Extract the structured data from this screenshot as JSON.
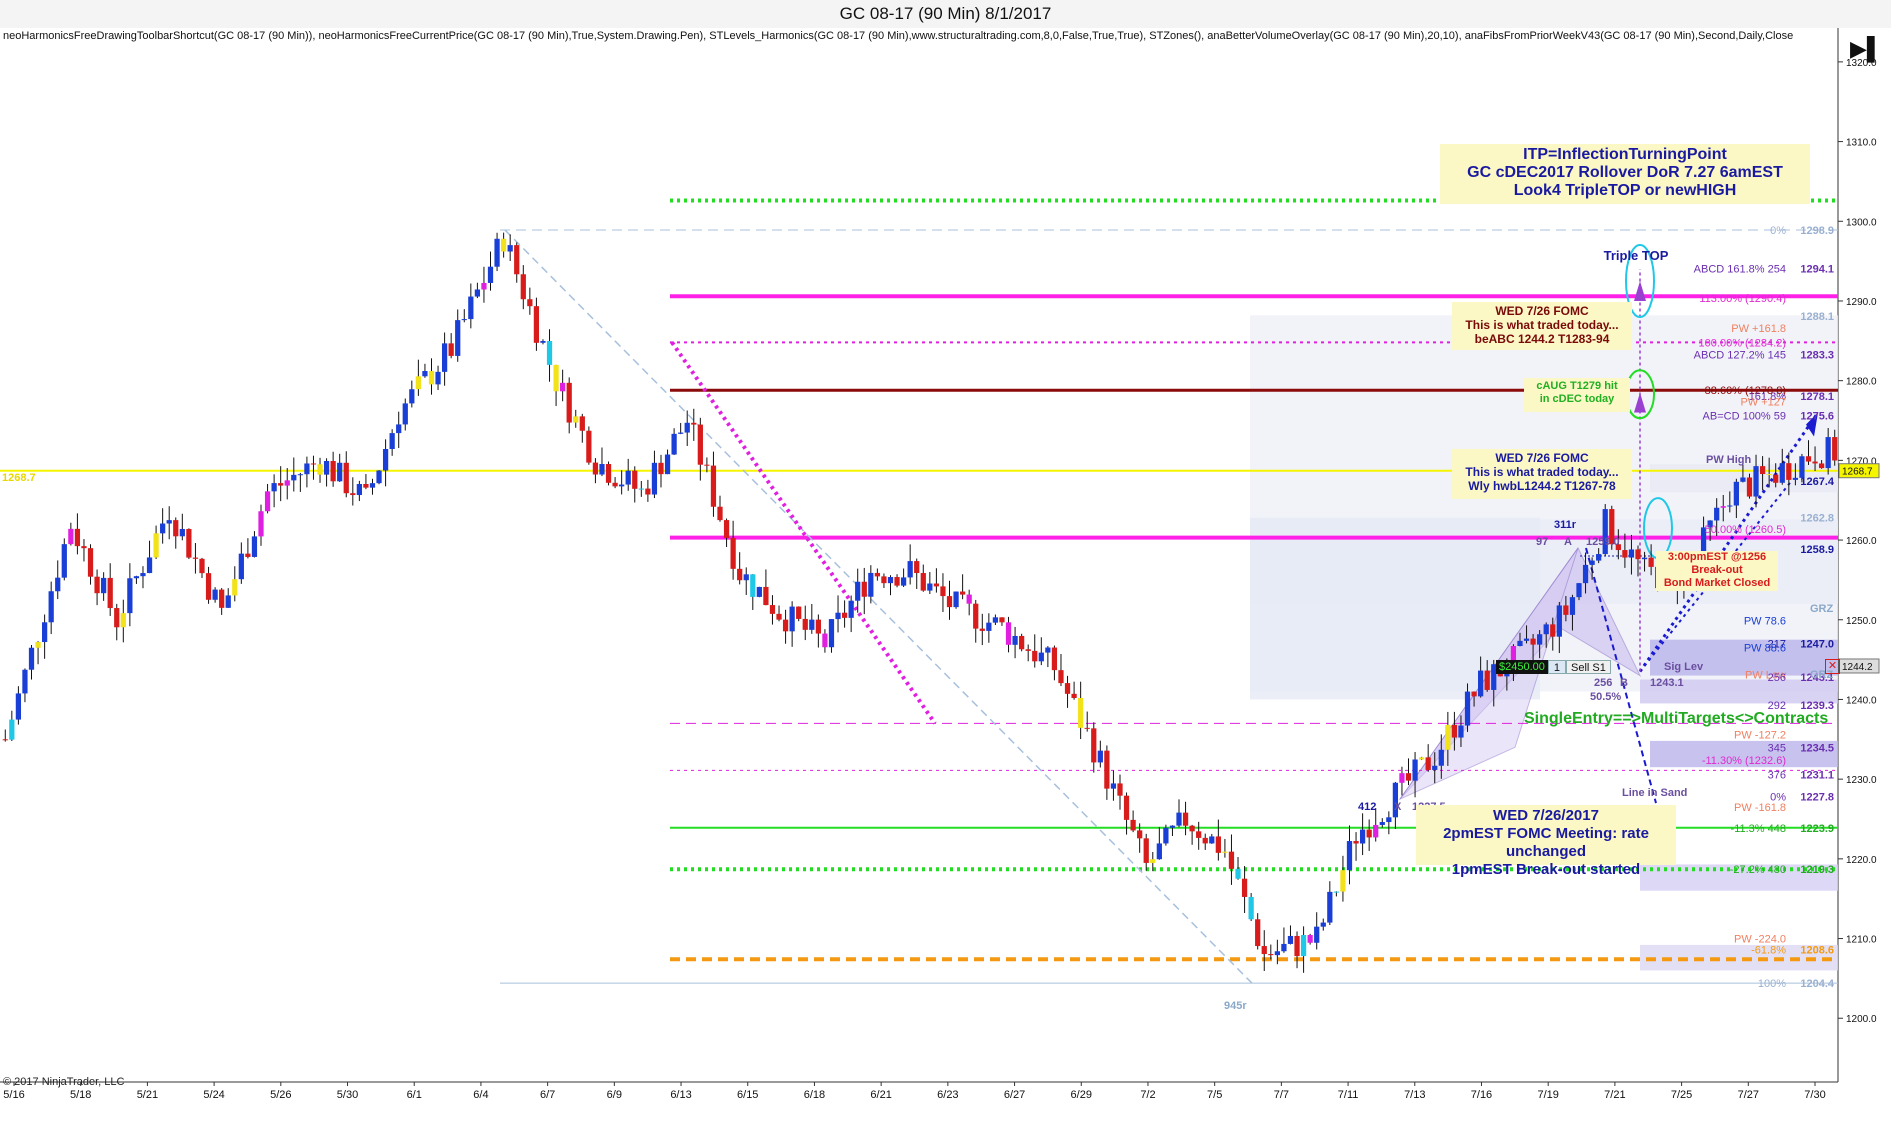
{
  "window": {
    "title": "GC 08-17 (90 Min)  8/1/2017"
  },
  "indicators_line": "neoHarmonicsFreeDrawingToolbarShortcut(GC 08-17 (90 Min)), neoHarmonicsFreeCurrentPrice(GC 08-17 (90 Min),True,System.Drawing.Pen), STLevels_Harmonics(GC 08-17 (90 Min),www.structuraltrading.com,8,0,False,True,True), STZones(), anaBetterVolumeOverlay(GC 08-17 (90 Min),20,10), anaFibsFromPriorWeekV43(GC 08-17 (90 Min),Second,Daily,Close",
  "copyright": "© 2017 NinjaTrader, LLC",
  "icons": {
    "play": "play-end-icon",
    "close_marker": "close-x-icon"
  },
  "colors": {
    "up_candle": "#1a3fd6",
    "down_candle": "#d81b1b",
    "doji_yellow": "#f2e21a",
    "doji_magenta": "#e020e0",
    "doji_cyan": "#20c8e8",
    "magenta_level": "#ff20e8",
    "darkred_level": "#8b0a0a",
    "yellow_level": "#f5f500",
    "green_level": "#22dd22",
    "orange_level": "#f39a11",
    "note_bg": "#fbf8c6"
  },
  "annotations": {
    "itp_box": [
      "ITP=InflectionTurningPoint",
      "GC cDEC2017 Rollover DoR 7.27 6amEST",
      "Look4 TripleTOP or newHIGH"
    ],
    "fomc_top": [
      "WED 7/26 FOMC",
      "This is what traded today...",
      "beABC 1244.2 T1283-94"
    ],
    "fomc_mid": [
      "WED 7/26 FOMC",
      "This is what traded today...",
      "Wly hwbL1244.2 T1267-78"
    ],
    "fomc_bottom": [
      "WED 7/26/2017",
      "2pmEST FOMC Meeting: rate unchanged",
      "1pmEST Break-out started"
    ],
    "triple_top": "Triple TOP",
    "caug": [
      "cAUG T1279 hit",
      "in cDEC today"
    ],
    "close_note": [
      "3:00pmEST @1256",
      "Break-out",
      "Bond Market Closed"
    ],
    "single_entry": "SingleEntry==>MultiTargets<>Contracts",
    "position": [
      "$2450.00",
      "1",
      "Sell S1"
    ],
    "line_in_sand": "Line in Sand",
    "left_price": "1268.7",
    "pattern_labels": [
      {
        "text": "311r",
        "color": "#1a1aa0"
      },
      {
        "text": "97",
        "color": "#6a4fa0"
      },
      {
        "text": "A",
        "color": "#6a4fa0"
      },
      {
        "text": "412",
        "color": "#1a1aa0"
      },
      {
        "text": "X",
        "color": "#6a4fa0"
      },
      {
        "text": "1227.5",
        "color": "#6a4fa0"
      },
      {
        "text": "945r",
        "color": "#8aa8c8"
      },
      {
        "text": "256",
        "color": "#6a4fa0"
      },
      {
        "text": "B",
        "color": "#6a4fa0"
      },
      {
        "text": "1243.1",
        "color": "#6a4fa0"
      },
      {
        "text": "50.5%",
        "color": "#6a4fa0"
      },
      {
        "text": "Sig Lev",
        "color": "#6a4fa0"
      },
      {
        "text": "1259.0",
        "color": "#6a4fa0"
      },
      {
        "text": "Line in Sand",
        "color": "#6a4fa0"
      },
      {
        "text": "PW High",
        "color": "#6a4fa0"
      },
      {
        "text": "GRZ",
        "color": "#8aa8c8"
      },
      {
        "text": "GRZ",
        "color": "#8aa8c8"
      }
    ]
  },
  "price_scale_tags": [
    {
      "price": 1268.7,
      "label": "1268.7",
      "bg": "#f5f500"
    },
    {
      "price": 1244.2,
      "label": "1244.2",
      "bg": "#dddddd"
    }
  ],
  "right_levels": [
    {
      "label": "0%",
      "price_text": "1298.9",
      "price": 1298.9,
      "color": "#9ab0d0"
    },
    {
      "label": "ABCD  161.8%  254",
      "price_text": "1294.1",
      "price": 1294.1,
      "color": "#6a2fb0"
    },
    {
      "label": "113.00% (1290.4)",
      "price_text": "",
      "price": 1290.4,
      "color": "#e02ad0"
    },
    {
      "label": "",
      "price_text": "1288.1",
      "price": 1288.1,
      "color": "#9ab0d0"
    },
    {
      "label": "PW +161.8",
      "price_text": "",
      "price": 1286.6,
      "color": "#f08060"
    },
    {
      "label": "100.00% (1284.2)",
      "price_text": "",
      "price": 1284.8,
      "color": "#e02ad0"
    },
    {
      "label": "ABCD  127.2%  145",
      "price_text": "1283.3",
      "price": 1283.3,
      "color": "#6a2fb0"
    },
    {
      "label": "88.60% (1278.8)",
      "price_text": "",
      "price": 1278.8,
      "color": "#8b0a0a"
    },
    {
      "label": "161.8%",
      "price_text": "1278.1",
      "price": 1278.1,
      "color": "#6a2fb0"
    },
    {
      "label": "PW +127",
      "price_text": "",
      "price": 1277.4,
      "color": "#f08060"
    },
    {
      "label": "AB=CD  100%  59",
      "price_text": "1275.6",
      "price": 1275.6,
      "color": "#6a2fb0"
    },
    {
      "label": "",
      "price_text": "1267.4",
      "price": 1267.4,
      "color": "#1a1aa0"
    },
    {
      "label": "",
      "price_text": "1262.8",
      "price": 1262.8,
      "color": "#9ab0d0"
    },
    {
      "label": "50.00% (1260.5)",
      "price_text": "",
      "price": 1261.4,
      "color": "#e02ad0"
    },
    {
      "label": "",
      "price_text": "1258.9",
      "price": 1258.9,
      "color": "#1a1aa0"
    },
    {
      "label": "PW 78.6",
      "price_text": "",
      "price": 1249.9,
      "color": "#1a3fd6"
    },
    {
      "label": "217",
      "price_text": "1247.0",
      "price": 1247.0,
      "color": "#1a1aa0"
    },
    {
      "label": "PW 88.6",
      "price_text": "",
      "price": 1246.5,
      "color": "#1a3fd6"
    },
    {
      "label": "PW Low",
      "price_text": "",
      "price": 1243.1,
      "color": "#f08060"
    },
    {
      "label": "256",
      "price_text": "1243.1",
      "price": 1242.8,
      "color": "#6a2fb0"
    },
    {
      "label": "292",
      "price_text": "1239.3",
      "price": 1239.3,
      "color": "#6a2fb0"
    },
    {
      "label": "PW -127.2",
      "price_text": "",
      "price": 1235.6,
      "color": "#f08060"
    },
    {
      "label": "345",
      "price_text": "1234.5",
      "price": 1234.0,
      "color": "#6a2fb0"
    },
    {
      "label": "-11.30% (1232.6)",
      "price_text": "",
      "price": 1232.4,
      "color": "#e02ad0"
    },
    {
      "label": "376",
      "price_text": "1231.1",
      "price": 1230.6,
      "color": "#6a2fb0"
    },
    {
      "label": "0%",
      "price_text": "1227.8",
      "price": 1227.8,
      "color": "#6a2fb0"
    },
    {
      "label": "PW -161.8",
      "price_text": "",
      "price": 1226.5,
      "color": "#f08060"
    },
    {
      "label": "-11.3%  448",
      "price_text": "1223.9",
      "price": 1223.9,
      "color": "#22aa22"
    },
    {
      "label": "-27.2%  480",
      "price_text": "1219.3",
      "price": 1218.7,
      "color": "#22aa22"
    },
    {
      "label": "PW -224.0",
      "price_text": "",
      "price": 1210.0,
      "color": "#f08060"
    },
    {
      "label": "-61.8%",
      "price_text": "1208.6",
      "price": 1208.6,
      "color": "#f39a11"
    },
    {
      "label": "100%",
      "price_text": "1204.4",
      "price": 1204.4,
      "color": "#9ab0d0"
    }
  ],
  "chart_data": {
    "type": "candlestick",
    "title": "GC 08-17 (90 Min)  8/1/2017",
    "ylim": [
      1192,
      1324
    ],
    "y_ticks": [
      1200.0,
      1210.0,
      1220.0,
      1230.0,
      1240.0,
      1250.0,
      1260.0,
      1270.0,
      1280.0,
      1290.0,
      1300.0,
      1310.0,
      1320.0
    ],
    "x_labels": [
      "5/16",
      "5/18",
      "5/21",
      "5/24",
      "5/26",
      "5/30",
      "6/1",
      "6/4",
      "6/7",
      "6/9",
      "6/13",
      "6/15",
      "6/18",
      "6/21",
      "6/23",
      "6/27",
      "6/29",
      "7/2",
      "7/5",
      "7/7",
      "7/11",
      "7/13",
      "7/16",
      "7/19",
      "7/21",
      "7/25",
      "7/27",
      "7/30"
    ],
    "close_path": [
      [
        0,
        1235
      ],
      [
        10,
        1262
      ],
      [
        17,
        1250
      ],
      [
        25,
        1264
      ],
      [
        33,
        1251
      ],
      [
        40,
        1266
      ],
      [
        48,
        1270
      ],
      [
        55,
        1265
      ],
      [
        60,
        1276
      ],
      [
        68,
        1284
      ],
      [
        76,
        1298
      ],
      [
        84,
        1280
      ],
      [
        90,
        1270
      ],
      [
        97,
        1266
      ],
      [
        104,
        1275
      ],
      [
        112,
        1256
      ],
      [
        118,
        1251
      ],
      [
        125,
        1247
      ],
      [
        132,
        1256
      ],
      [
        138,
        1256
      ],
      [
        144,
        1252
      ],
      [
        152,
        1249
      ],
      [
        160,
        1244
      ],
      [
        166,
        1234
      ],
      [
        174,
        1219
      ],
      [
        180,
        1225
      ],
      [
        186,
        1221
      ],
      [
        192,
        1208
      ],
      [
        200,
        1210
      ],
      [
        206,
        1223
      ],
      [
        212,
        1228
      ],
      [
        218,
        1233
      ],
      [
        225,
        1242
      ],
      [
        232,
        1246
      ],
      [
        238,
        1251
      ],
      [
        244,
        1262
      ],
      [
        250,
        1256
      ],
      [
        256,
        1255
      ],
      [
        263,
        1266
      ],
      [
        269,
        1268
      ],
      [
        276,
        1271
      ]
    ],
    "horizontal_levels": [
      {
        "price": 1302.6,
        "color": "#22dd22",
        "style": "dotted",
        "width": 4
      },
      {
        "price": 1298.9,
        "color": "#a8c0dc",
        "style": "dashed",
        "width": 1
      },
      {
        "price": 1290.6,
        "color": "#ff20e8",
        "style": "solid",
        "width": 4
      },
      {
        "price": 1284.8,
        "color": "#e020e0",
        "style": "dotted",
        "width": 2
      },
      {
        "price": 1278.8,
        "color": "#8b0a0a",
        "style": "solid",
        "width": 3
      },
      {
        "price": 1268.7,
        "color": "#f5f500",
        "style": "solid",
        "width": 2
      },
      {
        "price": 1260.3,
        "color": "#ff20e8",
        "style": "solid",
        "width": 4
      },
      {
        "price": 1237.0,
        "color": "#e020e0",
        "style": "dashed",
        "width": 1
      },
      {
        "price": 1231.1,
        "color": "#e020e0",
        "style": "dotted",
        "width": 1
      },
      {
        "price": 1223.9,
        "color": "#22dd22",
        "style": "solid",
        "width": 2
      },
      {
        "price": 1218.7,
        "color": "#22dd22",
        "style": "dotted",
        "width": 4
      },
      {
        "price": 1207.4,
        "color": "#f39a11",
        "style": "dashed",
        "width": 4
      },
      {
        "price": 1204.4,
        "color": "#a8c0dc",
        "style": "solid",
        "width": 1
      }
    ]
  }
}
